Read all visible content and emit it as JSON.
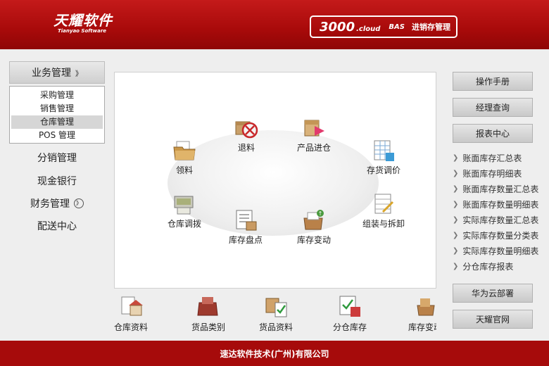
{
  "header": {
    "logo_cn": "天耀软件",
    "logo_en": "Tianyao Software",
    "product_version": "3000",
    "product_suffix": ".cloud",
    "product_bas": "BAS",
    "product_name": "进销存管理"
  },
  "left_nav": {
    "section_header": "业务管理",
    "submenu": [
      {
        "label": "采购管理"
      },
      {
        "label": "销售管理"
      },
      {
        "label": "仓库管理",
        "active": true
      },
      {
        "label": "POS 管理"
      }
    ],
    "items": [
      {
        "label": "分销管理"
      },
      {
        "label": "现金银行"
      },
      {
        "label": "财务管理"
      },
      {
        "label": "配送中心"
      }
    ]
  },
  "main": {
    "nodes": [
      {
        "label": "退料",
        "icon": "return-box-icon"
      },
      {
        "label": "产品进仓",
        "icon": "warehouse-in-icon"
      },
      {
        "label": "领料",
        "icon": "folder-icon"
      },
      {
        "label": "存货调价",
        "icon": "price-table-icon"
      },
      {
        "label": "仓库调拨",
        "icon": "transfer-icon"
      },
      {
        "label": "库存盘点",
        "icon": "inventory-count-icon"
      },
      {
        "label": "库存变动",
        "icon": "stock-change-icon"
      },
      {
        "label": "组装与拆卸",
        "icon": "assemble-icon"
      }
    ]
  },
  "bottom": {
    "shortcuts": [
      {
        "label": "仓库资料",
        "icon": "warehouse-icon"
      },
      {
        "label": "货品类别",
        "icon": "category-icon"
      },
      {
        "label": "货品资料",
        "icon": "goods-icon"
      },
      {
        "label": "分仓库存",
        "icon": "sub-warehouse-icon"
      },
      {
        "label": "库存变动",
        "icon": "stock-change-icon"
      }
    ]
  },
  "right": {
    "buttons": {
      "manual": "操作手册",
      "manager_query": "经理查询",
      "report_center": "报表中心",
      "huawei": "华为云部署",
      "official": "天耀官网"
    },
    "reports": [
      "账面库存汇总表",
      "账面库存明细表",
      "账面库存数量汇总表",
      "账面库存数量明细表",
      "实际库存数量汇总表",
      "实际库存数量分类表",
      "实际库存数量明细表",
      "分仓库存报表"
    ]
  },
  "footer": {
    "company": "速达软件技术(广州)有限公司"
  },
  "colors": {
    "brand_red": "#a60b0b",
    "header_red": "#c41a1a"
  }
}
